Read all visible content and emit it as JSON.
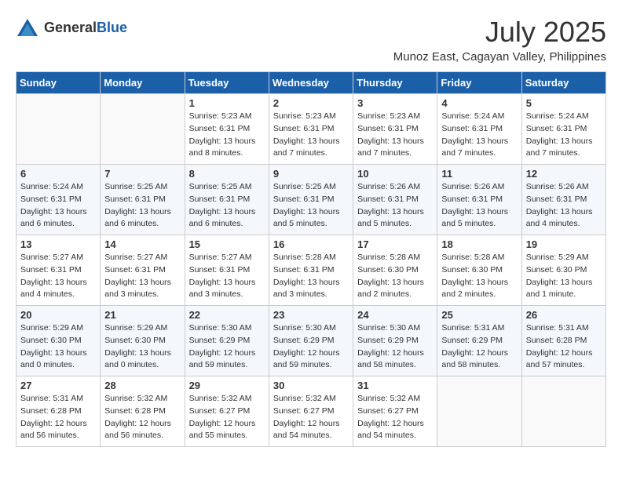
{
  "header": {
    "logo_general": "General",
    "logo_blue": "Blue",
    "month_title": "July 2025",
    "location": "Munoz East, Cagayan Valley, Philippines"
  },
  "weekdays": [
    "Sunday",
    "Monday",
    "Tuesday",
    "Wednesday",
    "Thursday",
    "Friday",
    "Saturday"
  ],
  "weeks": [
    [
      {
        "day": "",
        "info": ""
      },
      {
        "day": "",
        "info": ""
      },
      {
        "day": "1",
        "info": "Sunrise: 5:23 AM\nSunset: 6:31 PM\nDaylight: 13 hours and 8 minutes."
      },
      {
        "day": "2",
        "info": "Sunrise: 5:23 AM\nSunset: 6:31 PM\nDaylight: 13 hours and 7 minutes."
      },
      {
        "day": "3",
        "info": "Sunrise: 5:23 AM\nSunset: 6:31 PM\nDaylight: 13 hours and 7 minutes."
      },
      {
        "day": "4",
        "info": "Sunrise: 5:24 AM\nSunset: 6:31 PM\nDaylight: 13 hours and 7 minutes."
      },
      {
        "day": "5",
        "info": "Sunrise: 5:24 AM\nSunset: 6:31 PM\nDaylight: 13 hours and 7 minutes."
      }
    ],
    [
      {
        "day": "6",
        "info": "Sunrise: 5:24 AM\nSunset: 6:31 PM\nDaylight: 13 hours and 6 minutes."
      },
      {
        "day": "7",
        "info": "Sunrise: 5:25 AM\nSunset: 6:31 PM\nDaylight: 13 hours and 6 minutes."
      },
      {
        "day": "8",
        "info": "Sunrise: 5:25 AM\nSunset: 6:31 PM\nDaylight: 13 hours and 6 minutes."
      },
      {
        "day": "9",
        "info": "Sunrise: 5:25 AM\nSunset: 6:31 PM\nDaylight: 13 hours and 5 minutes."
      },
      {
        "day": "10",
        "info": "Sunrise: 5:26 AM\nSunset: 6:31 PM\nDaylight: 13 hours and 5 minutes."
      },
      {
        "day": "11",
        "info": "Sunrise: 5:26 AM\nSunset: 6:31 PM\nDaylight: 13 hours and 5 minutes."
      },
      {
        "day": "12",
        "info": "Sunrise: 5:26 AM\nSunset: 6:31 PM\nDaylight: 13 hours and 4 minutes."
      }
    ],
    [
      {
        "day": "13",
        "info": "Sunrise: 5:27 AM\nSunset: 6:31 PM\nDaylight: 13 hours and 4 minutes."
      },
      {
        "day": "14",
        "info": "Sunrise: 5:27 AM\nSunset: 6:31 PM\nDaylight: 13 hours and 3 minutes."
      },
      {
        "day": "15",
        "info": "Sunrise: 5:27 AM\nSunset: 6:31 PM\nDaylight: 13 hours and 3 minutes."
      },
      {
        "day": "16",
        "info": "Sunrise: 5:28 AM\nSunset: 6:31 PM\nDaylight: 13 hours and 3 minutes."
      },
      {
        "day": "17",
        "info": "Sunrise: 5:28 AM\nSunset: 6:30 PM\nDaylight: 13 hours and 2 minutes."
      },
      {
        "day": "18",
        "info": "Sunrise: 5:28 AM\nSunset: 6:30 PM\nDaylight: 13 hours and 2 minutes."
      },
      {
        "day": "19",
        "info": "Sunrise: 5:29 AM\nSunset: 6:30 PM\nDaylight: 13 hours and 1 minute."
      }
    ],
    [
      {
        "day": "20",
        "info": "Sunrise: 5:29 AM\nSunset: 6:30 PM\nDaylight: 13 hours and 0 minutes."
      },
      {
        "day": "21",
        "info": "Sunrise: 5:29 AM\nSunset: 6:30 PM\nDaylight: 13 hours and 0 minutes."
      },
      {
        "day": "22",
        "info": "Sunrise: 5:30 AM\nSunset: 6:29 PM\nDaylight: 12 hours and 59 minutes."
      },
      {
        "day": "23",
        "info": "Sunrise: 5:30 AM\nSunset: 6:29 PM\nDaylight: 12 hours and 59 minutes."
      },
      {
        "day": "24",
        "info": "Sunrise: 5:30 AM\nSunset: 6:29 PM\nDaylight: 12 hours and 58 minutes."
      },
      {
        "day": "25",
        "info": "Sunrise: 5:31 AM\nSunset: 6:29 PM\nDaylight: 12 hours and 58 minutes."
      },
      {
        "day": "26",
        "info": "Sunrise: 5:31 AM\nSunset: 6:28 PM\nDaylight: 12 hours and 57 minutes."
      }
    ],
    [
      {
        "day": "27",
        "info": "Sunrise: 5:31 AM\nSunset: 6:28 PM\nDaylight: 12 hours and 56 minutes."
      },
      {
        "day": "28",
        "info": "Sunrise: 5:32 AM\nSunset: 6:28 PM\nDaylight: 12 hours and 56 minutes."
      },
      {
        "day": "29",
        "info": "Sunrise: 5:32 AM\nSunset: 6:27 PM\nDaylight: 12 hours and 55 minutes."
      },
      {
        "day": "30",
        "info": "Sunrise: 5:32 AM\nSunset: 6:27 PM\nDaylight: 12 hours and 54 minutes."
      },
      {
        "day": "31",
        "info": "Sunrise: 5:32 AM\nSunset: 6:27 PM\nDaylight: 12 hours and 54 minutes."
      },
      {
        "day": "",
        "info": ""
      },
      {
        "day": "",
        "info": ""
      }
    ]
  ]
}
